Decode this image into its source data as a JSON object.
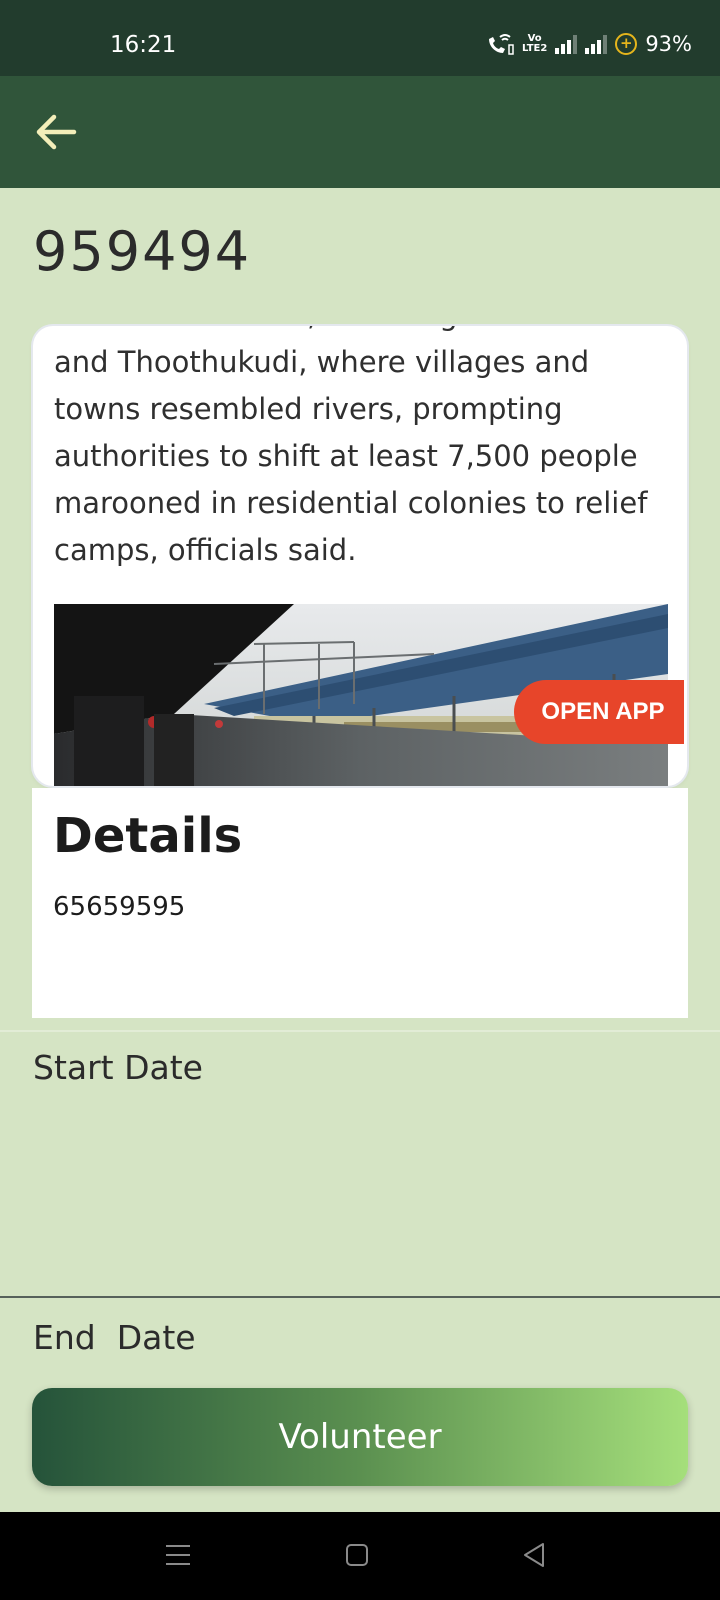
{
  "status_bar": {
    "time": "16:21",
    "volte_label": "Vo\nLTE2",
    "battery": "93%",
    "icons": [
      "wifi-calling-icon",
      "volte-icon",
      "signal-icon",
      "signal-icon",
      "battery-saver-icon"
    ]
  },
  "app_bar": {
    "back_icon": "arrow-left-icon"
  },
  "page": {
    "title": "959494"
  },
  "news_card": {
    "text": "southern districts, including Tirunelveli and Thoothukudi, where villages and towns resembled rivers, prompting authorities to shift at least 7,500 people marooned in residential colonies to relief camps, officials said.",
    "open_app_label": "OPEN APP"
  },
  "details": {
    "title": "Details",
    "value": "65659595"
  },
  "fields": {
    "start_date_label": "Start Date",
    "end_date_label": "End  Date"
  },
  "actions": {
    "volunteer_label": "Volunteer"
  },
  "colors": {
    "background": "#d5e4c4",
    "status_bar": "#223c2d",
    "app_bar": "#30553a",
    "accent_orange": "#e7452a",
    "button_gradient_start": "#25533a",
    "button_gradient_end": "#a5df7b"
  },
  "nav_bar": {
    "icons": [
      "menu-icon",
      "home-icon",
      "back-triangle-icon"
    ]
  }
}
